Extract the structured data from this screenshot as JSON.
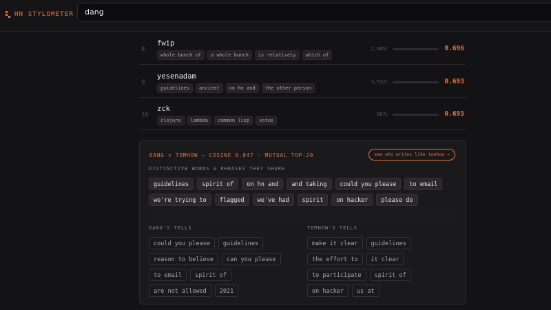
{
  "brand": {
    "name": "HN STYLOMETER",
    "accent": "#e8743a"
  },
  "search": {
    "value": "dang"
  },
  "results": [
    {
      "rank": "8",
      "username": "fwip",
      "tags": [
        "whole bunch of",
        "a whole bunch",
        "is relatively",
        "which of"
      ],
      "count": "2,465c",
      "score": "0.696"
    },
    {
      "rank": "9",
      "username": "yesenadam",
      "tags": [
        "guidelines",
        "ancient",
        "on hn and",
        "the other person"
      ],
      "count": "3,532c",
      "score": "0.693"
    },
    {
      "rank": "10",
      "username": "zck",
      "tags": [
        "clojure",
        "lambda",
        "common lisp",
        "votes"
      ],
      "count": "867c",
      "score": "0.693"
    }
  ],
  "comparison": {
    "heading": "DANG × TOMHOW — COSINE 0.847 · MUTUAL TOP-20",
    "cta_label": "see who writes like tomhow →",
    "shared_label": "DISTINCTIVE WORDS & PHRASES THEY SHARE",
    "shared": [
      "guidelines",
      "spirit of",
      "on hn and",
      "and taking",
      "could you please",
      "to email",
      "we're trying to",
      "flagged",
      "we've had",
      "spirit",
      "on hacker",
      "please do"
    ],
    "left_label": "DANG'S TELLS",
    "left": [
      "could you please",
      "guidelines",
      "reason to believe",
      "can you please",
      "to email",
      "spirit of",
      "are not allowed",
      "2021"
    ],
    "right_label": "TOMHOW'S TELLS",
    "right": [
      "make it clear",
      "guidelines",
      "the effort to",
      "it clear",
      "to participate",
      "spirit of",
      "on hacker",
      "us at"
    ]
  }
}
